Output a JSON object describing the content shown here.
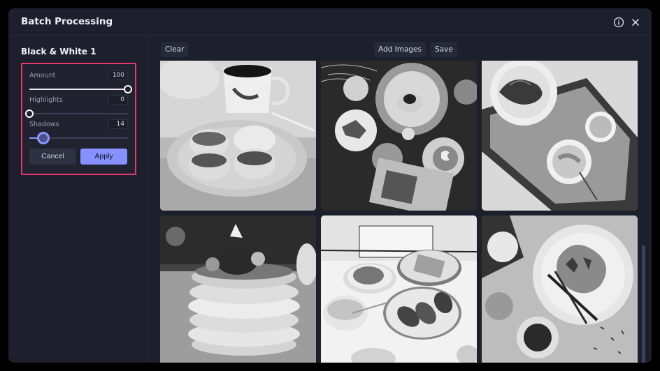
{
  "modal": {
    "title": "Batch Processing",
    "icons": {
      "info": "info-circle-icon",
      "close": "close-x-icon"
    }
  },
  "sidebar": {
    "preset_name": "Black & White 1",
    "adjustments": [
      {
        "label": "Amount",
        "value": "100",
        "fraction": 1.0
      },
      {
        "label": "Highlights",
        "value": "0",
        "fraction": 0.0
      },
      {
        "label": "Shadows",
        "value": "14",
        "fraction": 0.14
      }
    ],
    "cancel_label": "Cancel",
    "apply_label": "Apply"
  },
  "toolbar": {
    "clear_label": "Clear",
    "add_images_label": "Add Images",
    "save_label": "Save"
  },
  "gallery": {
    "images": [
      {
        "alt": "Black and white photo of pastries with almonds on a plate and a coffee cup"
      },
      {
        "alt": "Black and white overhead photo of table with plates, latte art and photographs"
      },
      {
        "alt": "Black and white photo of croissant and bowl on a breakfast tray"
      },
      {
        "alt": "Black and white photo of a stack of pancakes with berries and syrup"
      },
      {
        "alt": "Black and white photo of breakfast table with waffles, croissants and oatmeal"
      },
      {
        "alt": "Black and white overhead photo of salad plate with fork and knife and coffee"
      }
    ]
  },
  "colors": {
    "accent": "#8790ff",
    "highlight_border": "#e8386b",
    "background": "#1d1f2c"
  }
}
